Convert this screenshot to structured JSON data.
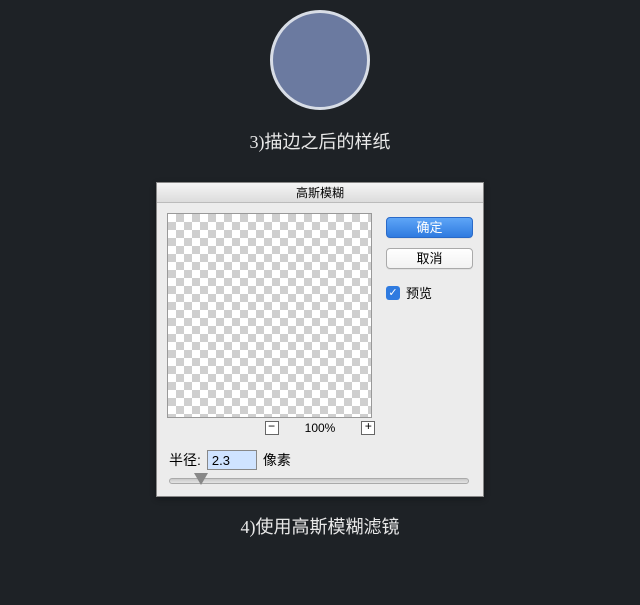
{
  "sample": {
    "caption": "3)描边之后的样纸"
  },
  "dialog": {
    "title": "高斯模糊",
    "ok_label": "确定",
    "cancel_label": "取消",
    "preview_label": "预览",
    "zoom": {
      "out": "−",
      "level": "100%",
      "in": "+"
    },
    "radius": {
      "label": "半径:",
      "value": "2.3",
      "unit": "像素"
    },
    "preview_checked": true
  },
  "bottom_caption": "4)使用高斯模糊滤镜"
}
